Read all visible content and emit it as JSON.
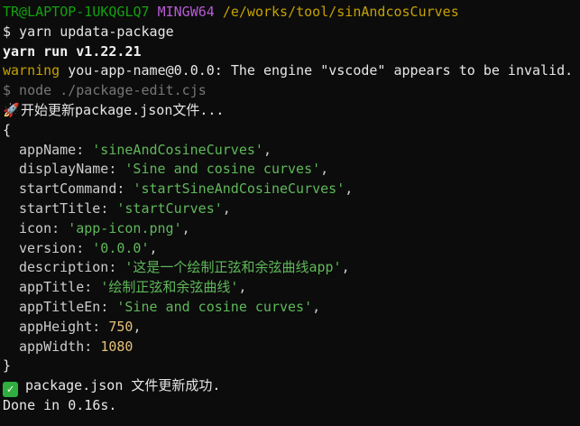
{
  "prompt": {
    "user_host": "TR@LAPTOP-1UKQGLQ7",
    "shell": "MINGW64",
    "path": "/e/works/tool/sinAndcosCurves"
  },
  "command": "$ yarn updata-package",
  "yarn_version": "yarn run v1.22.21",
  "warning": {
    "label": "warning",
    "message": " you-app-name@0.0.0: The engine \"vscode\" appears to be invalid."
  },
  "node_command": "$ node ./package-edit.cjs",
  "rocket_icon": "🚀",
  "start_message": "开始更新package.json文件...",
  "open_brace": "{",
  "close_brace": "}",
  "fields": [
    {
      "key": "appName",
      "value": "'sineAndCosineCurves'",
      "type": "string",
      "comma": ","
    },
    {
      "key": "displayName",
      "value": "'Sine and cosine curves'",
      "type": "string",
      "comma": ","
    },
    {
      "key": "startCommand",
      "value": "'startSineAndCosineCurves'",
      "type": "string",
      "comma": ","
    },
    {
      "key": "startTitle",
      "value": "'startCurves'",
      "type": "string",
      "comma": ","
    },
    {
      "key": "icon",
      "value": "'app-icon.png'",
      "type": "string",
      "comma": ","
    },
    {
      "key": "version",
      "value": "'0.0.0'",
      "type": "string",
      "comma": ","
    },
    {
      "key": "description",
      "value": "'这是一个绘制正弦和余弦曲线app'",
      "type": "string",
      "comma": ","
    },
    {
      "key": "appTitle",
      "value": "'绘制正弦和余弦曲线'",
      "type": "string",
      "comma": ","
    },
    {
      "key": "appTitleEn",
      "value": "'Sine and cosine curves'",
      "type": "string",
      "comma": ","
    },
    {
      "key": "appHeight",
      "value": "750",
      "type": "number",
      "comma": ","
    },
    {
      "key": "appWidth",
      "value": "1080",
      "type": "number",
      "comma": ""
    }
  ],
  "success_icon": "check-mark-icon",
  "success_check": "✓",
  "success_message": "package.json 文件更新成功.",
  "done": "Done in 0.16s."
}
